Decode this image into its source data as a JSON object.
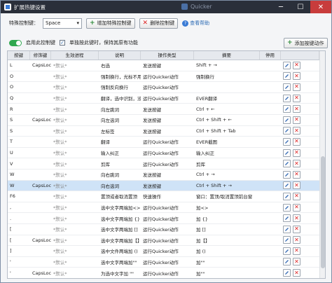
{
  "window": {
    "title": "扩展热键设置",
    "background_app": "Quicker",
    "close_icon": "close-icon",
    "minimize_icon": "minimize-icon",
    "maximize_icon": "maximize-icon"
  },
  "toolbar": {
    "special_key_label": "特殊控制键：",
    "special_key_value": "Space",
    "add_button": "增加特殊控制键",
    "delete_button": "删除控制键",
    "help_link": "查看帮助"
  },
  "options": {
    "enable_label": "启用此控制键",
    "single_press_label": "单独按此键时，保持其原有功能",
    "add_action_button": "添加按键动作",
    "enabled": true,
    "single_press_checked": true
  },
  "table": {
    "headers": [
      "按键",
      "修饰键",
      "生效进程",
      "说明",
      "操作类型",
      "摘要",
      "停用",
      ""
    ],
    "rows": [
      {
        "key": "L",
        "mod": "CapsLoc",
        "proc": "*默认*",
        "desc": "右选",
        "type": "发送按键",
        "summary": "Shift + →"
      },
      {
        "key": "O",
        "mod": "",
        "proc": "*默认*",
        "desc": "强制换行，光标不用",
        "type": "运行Quicker动作",
        "summary": "强制换行"
      },
      {
        "key": "O",
        "mod": "",
        "proc": "*默认*",
        "desc": "强制反向换行",
        "type": "运行Quicker动作",
        "summary": ""
      },
      {
        "key": "Q",
        "mod": "",
        "proc": "*默认*",
        "desc": "翻译，选中识别，没",
        "type": "运行Quicker动作",
        "summary": "EVER翻译"
      },
      {
        "key": "R",
        "mod": "",
        "proc": "*默认*",
        "desc": "向左跳词",
        "type": "发送按键",
        "summary": "Ctrl + ←"
      },
      {
        "key": "S",
        "mod": "CapsLoc",
        "proc": "*默认*",
        "desc": "向左选词",
        "type": "发送按键",
        "summary": "Ctrl + Shift + ←"
      },
      {
        "key": "S",
        "mod": "",
        "proc": "*默认*",
        "desc": "左标签",
        "type": "发送按键",
        "summary": "Ctrl + Shift + Tab"
      },
      {
        "key": "T",
        "mod": "",
        "proc": "*默认*",
        "desc": "翻译",
        "type": "运行Quicker动作",
        "summary": "EVER截图"
      },
      {
        "key": "U",
        "mod": "",
        "proc": "*默认*",
        "desc": "输入纠正",
        "type": "运行Quicker动作",
        "summary": "输入纠正"
      },
      {
        "key": "V",
        "mod": "",
        "proc": "*默认*",
        "desc": "剪库",
        "type": "运行Quicker动作",
        "summary": "剪库"
      },
      {
        "key": "W",
        "mod": "",
        "proc": "*默认*",
        "desc": "向右跳词",
        "type": "发送按键",
        "summary": "Ctrl + →"
      },
      {
        "key": "W",
        "mod": "CapsLoc",
        "proc": "*默认*",
        "desc": "向右选词",
        "type": "发送按键",
        "summary": "Ctrl + Shift + →",
        "selected": true
      },
      {
        "key": "F6",
        "mod": "",
        "proc": "*默认*",
        "desc": "置顶或者取消置顶",
        "type": "快速操作",
        "summary": "窗口：置顶/取消置顶前台窗"
      },
      {
        "key": ",",
        "mod": "",
        "proc": "*默认*",
        "desc": "选中文字两端加<>",
        "type": "运行Quicker动作",
        "summary": "加<>"
      },
      {
        "key": ".",
        "mod": "",
        "proc": "*默认*",
        "desc": "选中文字两端加 {}",
        "type": "运行Quicker动作",
        "summary": "加 {}"
      },
      {
        "key": "[",
        "mod": "",
        "proc": "*默认*",
        "desc": "选中文字两端加 []",
        "type": "运行Quicker动作",
        "summary": "加 []"
      },
      {
        "key": "[",
        "mod": "CapsLoc",
        "proc": "*默认*",
        "desc": "选中文字两端加【】",
        "type": "运行Quicker动作",
        "summary": "加【】"
      },
      {
        "key": "]",
        "mod": "",
        "proc": "*默认*",
        "desc": "选中文件两端加 ()",
        "type": "运行Quicker动作",
        "summary": "加 ()"
      },
      {
        "key": "'",
        "mod": "",
        "proc": "*默认*",
        "desc": "选中文字两端加\"\"",
        "type": "运行Quicker动作",
        "summary": "加\"\""
      },
      {
        "key": "'",
        "mod": "CapsLoc",
        "proc": "*默认*",
        "desc": "为选中文字加 \"\"",
        "type": "运行Quicker动作",
        "summary": "加\"\""
      }
    ]
  },
  "icons": {
    "edit": "pencil-icon",
    "delete": "delete-x-icon"
  },
  "colors": {
    "titlebar": "#2a2f3a",
    "toggle_on": "#2fa84f",
    "selected_row": "#cfe3f7",
    "delete_red": "#dd2222",
    "link_blue": "#2f6db5"
  }
}
